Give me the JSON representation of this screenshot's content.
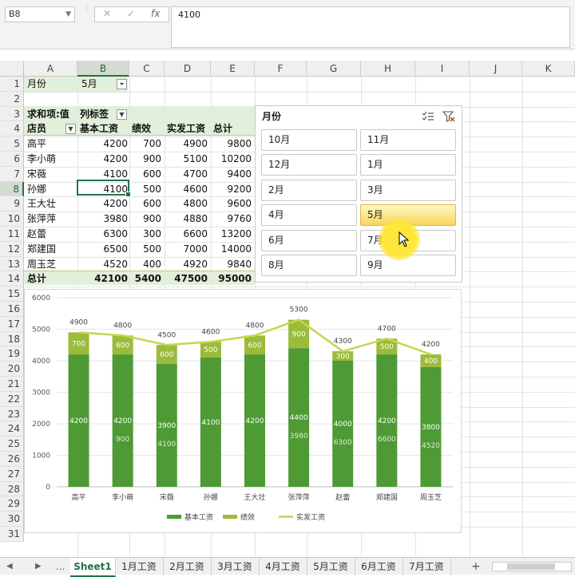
{
  "formula_bar": {
    "name_box": "B8",
    "cancel": "✕",
    "enter": "✓",
    "fx": "fx",
    "formula": "4100"
  },
  "columns": [
    "A",
    "B",
    "C",
    "D",
    "E",
    "F",
    "G",
    "H",
    "I",
    "J",
    "K"
  ],
  "rows": [
    "1",
    "2",
    "3",
    "4",
    "5",
    "6",
    "7",
    "8",
    "9",
    "10",
    "11",
    "12",
    "13",
    "14",
    "15",
    "16",
    "17",
    "18",
    "19",
    "20",
    "21",
    "22",
    "23",
    "24",
    "25",
    "26",
    "27",
    "28",
    "29",
    "30",
    "31"
  ],
  "pivot": {
    "filter_label": "月份",
    "filter_value": "5月",
    "values_label": "求和项:值",
    "col_labels": "列标签",
    "row_label": "店员",
    "headers": [
      "基本工资",
      "绩效",
      "实发工资",
      "总计"
    ],
    "data": [
      [
        "高平",
        "4200",
        "700",
        "4900",
        "9800"
      ],
      [
        "李小萌",
        "4200",
        "900",
        "5100",
        "10200"
      ],
      [
        "宋薇",
        "4100",
        "600",
        "4700",
        "9400"
      ],
      [
        "孙娜",
        "4100",
        "500",
        "4600",
        "9200"
      ],
      [
        "王大壮",
        "4200",
        "600",
        "4800",
        "9600"
      ],
      [
        "张萍萍",
        "3980",
        "900",
        "4880",
        "9760"
      ],
      [
        "赵蕾",
        "6300",
        "300",
        "6600",
        "13200"
      ],
      [
        "郑建国",
        "6500",
        "500",
        "7000",
        "14000"
      ],
      [
        "周玉芝",
        "4520",
        "400",
        "4920",
        "9840"
      ]
    ],
    "total": [
      "总计",
      "42100",
      "5400",
      "47500",
      "95000"
    ]
  },
  "slicer": {
    "title": "月份",
    "items": [
      "10月",
      "11月",
      "12月",
      "1月",
      "2月",
      "3月",
      "4月",
      "5月",
      "6月",
      "7月",
      "8月",
      "9月"
    ],
    "selected": "5月"
  },
  "chart_data": {
    "type": "bar",
    "categories": [
      "高平",
      "李小萌",
      "宋薇",
      "孙娜",
      "王大壮",
      "张萍萍",
      "赵蕾",
      "郑建国",
      "周玉芝"
    ],
    "ylim": [
      0,
      6000
    ],
    "yticks": [
      0,
      1000,
      2000,
      3000,
      4000,
      5000,
      6000
    ],
    "series": [
      {
        "name": "基本工资",
        "type": "bar",
        "color": "#4e9a35",
        "values": [
          4200,
          4200,
          3900,
          4100,
          4200,
          4400,
          4000,
          4200,
          3800
        ]
      },
      {
        "name": "绩效",
        "type": "bar",
        "color": "#9bbb3a",
        "values": [
          700,
          600,
          600,
          500,
          600,
          900,
          300,
          500,
          400
        ]
      },
      {
        "name": "实发工资",
        "type": "line",
        "color": "#c8d44e",
        "values": [
          4900,
          4800,
          4500,
          4600,
          4800,
          5300,
          4300,
          4700,
          4200
        ]
      }
    ],
    "ghost_labels": [
      {
        "category": "李小萌",
        "lines": [
          "900"
        ]
      },
      {
        "category": "宋薇",
        "lines": [
          "4100"
        ]
      },
      {
        "category": "张萍萍",
        "lines": [
          "3980"
        ]
      },
      {
        "category": "赵蕾",
        "lines": [
          "6300"
        ]
      },
      {
        "category": "郑建国",
        "lines": [
          "6600"
        ]
      },
      {
        "category": "周玉芝",
        "lines": [
          "4520"
        ]
      }
    ]
  },
  "sheet_tabs": [
    "Sheet1",
    "1月工资",
    "2月工资",
    "3月工资",
    "4月工资",
    "5月工资",
    "6月工资",
    "7月工资"
  ],
  "active_tab": "Sheet1",
  "nav": {
    "prev": "◀",
    "next": "▶",
    "more": "...",
    "add": "+"
  },
  "colors": {
    "accent": "#217346",
    "pivot_header_bg": "#e2efda",
    "slicer_selected": "#f6d659"
  }
}
